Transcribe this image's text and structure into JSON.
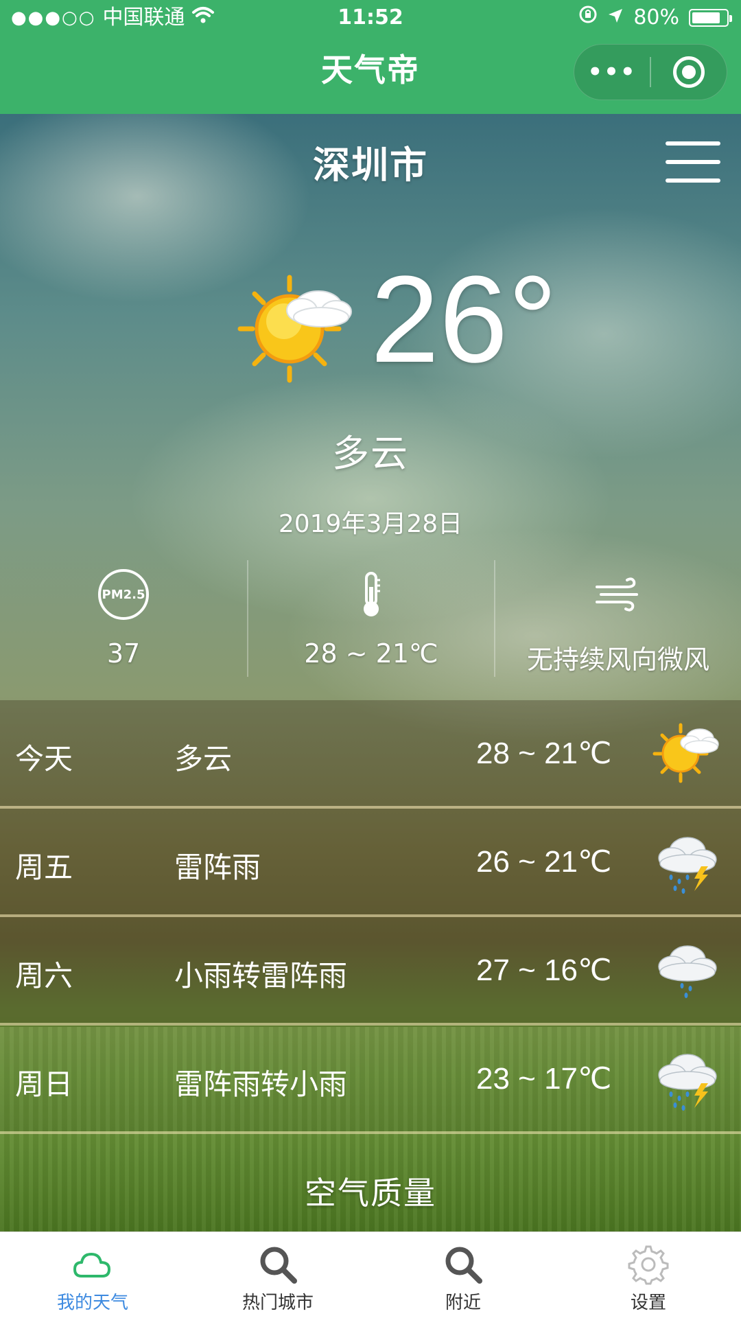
{
  "status_bar": {
    "signal": "●●●○○",
    "carrier": "中国联通",
    "time": "11:52",
    "battery": "80%"
  },
  "nav": {
    "title": "天气帝",
    "more_label": "•••"
  },
  "weather": {
    "city": "深圳市",
    "temperature": "26°",
    "condition": "多云",
    "date": "2019年3月28日",
    "stats": {
      "pm25_label": "PM2.5",
      "pm25_value": "37",
      "temp_range": "28 ~ 21℃",
      "wind": "无持续风向微风"
    }
  },
  "forecast": [
    {
      "day": "今天",
      "desc": "多云",
      "range": "28 ~ 21℃",
      "icon": "partly-cloudy-icon"
    },
    {
      "day": "周五",
      "desc": "雷阵雨",
      "range": "26 ~ 21℃",
      "icon": "thunderstorm-icon"
    },
    {
      "day": "周六",
      "desc": "小雨转雷阵雨",
      "range": "27 ~ 16℃",
      "icon": "light-rain-icon"
    },
    {
      "day": "周日",
      "desc": "雷阵雨转小雨",
      "range": "23 ~ 17℃",
      "icon": "thunderstorm-icon"
    }
  ],
  "air_quality": {
    "title": "空气质量"
  },
  "tabs": [
    {
      "label": "我的天气",
      "icon": "cloud-icon",
      "active": true
    },
    {
      "label": "热门城市",
      "icon": "search-icon",
      "active": false
    },
    {
      "label": "附近",
      "icon": "search-icon",
      "active": false
    },
    {
      "label": "设置",
      "icon": "gear-icon",
      "active": false
    }
  ],
  "colors": {
    "nav_green": "#3cb26a",
    "active_tab_blue": "#3d8ae0",
    "tab_icon_green": "#2eb86b",
    "tab_icon_gray": "#555555"
  }
}
